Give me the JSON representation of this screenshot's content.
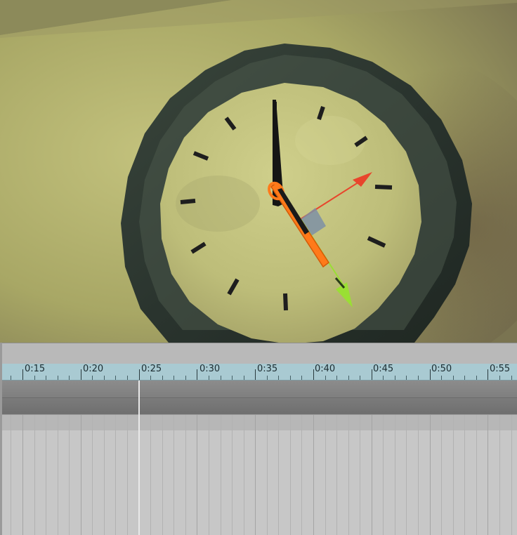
{
  "viewport": {
    "scene": "wall-clock",
    "gizmo": "move-transform-gizmo",
    "gizmo_axes": {
      "x_color": "#e8452c",
      "y_color": "#9adf34",
      "selection_color": "#ff7a1a"
    }
  },
  "timeline": {
    "ruler_labels": [
      "0:15",
      "0:20",
      "0:25",
      "0:30",
      "0:35",
      "0:40",
      "0:45",
      "0:50",
      "0:55"
    ],
    "colors": {
      "ruler": "#a9cad2",
      "track": "#8c8c8c",
      "grid": "#c7c7c7",
      "playhead": "#e9e9e9"
    }
  }
}
